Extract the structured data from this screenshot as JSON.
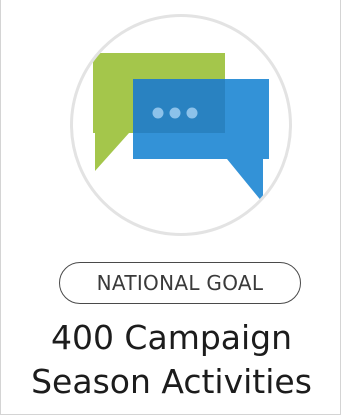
{
  "card": {
    "icon": "chat-bubbles-icon",
    "badge": "NATIONAL GOAL",
    "title_line1": "400 Campaign",
    "title_line2": "Season Activities"
  },
  "colors": {
    "green_bubble": "#a4c64b",
    "blue_bubble": "#2c8ed6",
    "dots": "#8cc2ea",
    "circle_border": "#e3e3e3",
    "badge_border": "#4a4a4a",
    "title_text": "#1c1c1c"
  }
}
